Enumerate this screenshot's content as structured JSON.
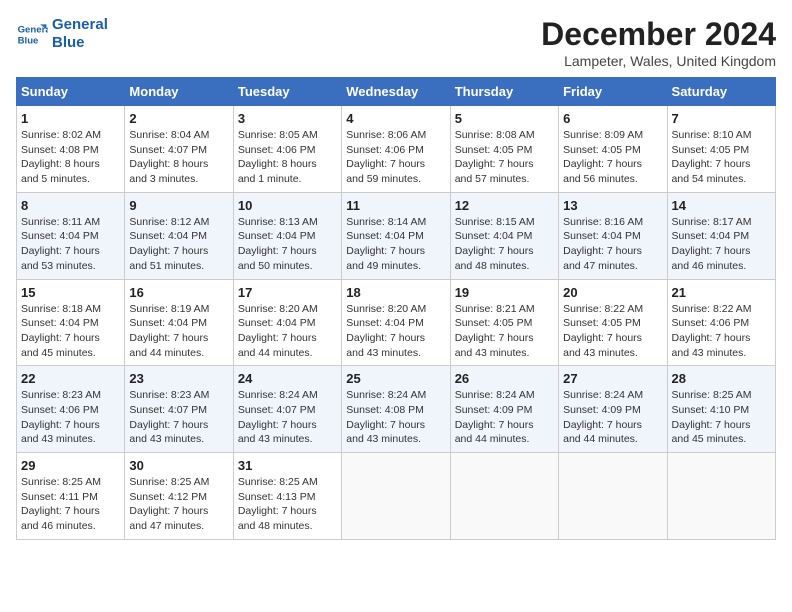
{
  "header": {
    "logo_line1": "General",
    "logo_line2": "Blue",
    "title": "December 2024",
    "location": "Lampeter, Wales, United Kingdom"
  },
  "columns": [
    "Sunday",
    "Monday",
    "Tuesday",
    "Wednesday",
    "Thursday",
    "Friday",
    "Saturday"
  ],
  "weeks": [
    [
      {
        "day": "1",
        "info": "Sunrise: 8:02 AM\nSunset: 4:08 PM\nDaylight: 8 hours\nand 5 minutes."
      },
      {
        "day": "2",
        "info": "Sunrise: 8:04 AM\nSunset: 4:07 PM\nDaylight: 8 hours\nand 3 minutes."
      },
      {
        "day": "3",
        "info": "Sunrise: 8:05 AM\nSunset: 4:06 PM\nDaylight: 8 hours\nand 1 minute."
      },
      {
        "day": "4",
        "info": "Sunrise: 8:06 AM\nSunset: 4:06 PM\nDaylight: 7 hours\nand 59 minutes."
      },
      {
        "day": "5",
        "info": "Sunrise: 8:08 AM\nSunset: 4:05 PM\nDaylight: 7 hours\nand 57 minutes."
      },
      {
        "day": "6",
        "info": "Sunrise: 8:09 AM\nSunset: 4:05 PM\nDaylight: 7 hours\nand 56 minutes."
      },
      {
        "day": "7",
        "info": "Sunrise: 8:10 AM\nSunset: 4:05 PM\nDaylight: 7 hours\nand 54 minutes."
      }
    ],
    [
      {
        "day": "8",
        "info": "Sunrise: 8:11 AM\nSunset: 4:04 PM\nDaylight: 7 hours\nand 53 minutes."
      },
      {
        "day": "9",
        "info": "Sunrise: 8:12 AM\nSunset: 4:04 PM\nDaylight: 7 hours\nand 51 minutes."
      },
      {
        "day": "10",
        "info": "Sunrise: 8:13 AM\nSunset: 4:04 PM\nDaylight: 7 hours\nand 50 minutes."
      },
      {
        "day": "11",
        "info": "Sunrise: 8:14 AM\nSunset: 4:04 PM\nDaylight: 7 hours\nand 49 minutes."
      },
      {
        "day": "12",
        "info": "Sunrise: 8:15 AM\nSunset: 4:04 PM\nDaylight: 7 hours\nand 48 minutes."
      },
      {
        "day": "13",
        "info": "Sunrise: 8:16 AM\nSunset: 4:04 PM\nDaylight: 7 hours\nand 47 minutes."
      },
      {
        "day": "14",
        "info": "Sunrise: 8:17 AM\nSunset: 4:04 PM\nDaylight: 7 hours\nand 46 minutes."
      }
    ],
    [
      {
        "day": "15",
        "info": "Sunrise: 8:18 AM\nSunset: 4:04 PM\nDaylight: 7 hours\nand 45 minutes."
      },
      {
        "day": "16",
        "info": "Sunrise: 8:19 AM\nSunset: 4:04 PM\nDaylight: 7 hours\nand 44 minutes."
      },
      {
        "day": "17",
        "info": "Sunrise: 8:20 AM\nSunset: 4:04 PM\nDaylight: 7 hours\nand 44 minutes."
      },
      {
        "day": "18",
        "info": "Sunrise: 8:20 AM\nSunset: 4:04 PM\nDaylight: 7 hours\nand 43 minutes."
      },
      {
        "day": "19",
        "info": "Sunrise: 8:21 AM\nSunset: 4:05 PM\nDaylight: 7 hours\nand 43 minutes."
      },
      {
        "day": "20",
        "info": "Sunrise: 8:22 AM\nSunset: 4:05 PM\nDaylight: 7 hours\nand 43 minutes."
      },
      {
        "day": "21",
        "info": "Sunrise: 8:22 AM\nSunset: 4:06 PM\nDaylight: 7 hours\nand 43 minutes."
      }
    ],
    [
      {
        "day": "22",
        "info": "Sunrise: 8:23 AM\nSunset: 4:06 PM\nDaylight: 7 hours\nand 43 minutes."
      },
      {
        "day": "23",
        "info": "Sunrise: 8:23 AM\nSunset: 4:07 PM\nDaylight: 7 hours\nand 43 minutes."
      },
      {
        "day": "24",
        "info": "Sunrise: 8:24 AM\nSunset: 4:07 PM\nDaylight: 7 hours\nand 43 minutes."
      },
      {
        "day": "25",
        "info": "Sunrise: 8:24 AM\nSunset: 4:08 PM\nDaylight: 7 hours\nand 43 minutes."
      },
      {
        "day": "26",
        "info": "Sunrise: 8:24 AM\nSunset: 4:09 PM\nDaylight: 7 hours\nand 44 minutes."
      },
      {
        "day": "27",
        "info": "Sunrise: 8:24 AM\nSunset: 4:09 PM\nDaylight: 7 hours\nand 44 minutes."
      },
      {
        "day": "28",
        "info": "Sunrise: 8:25 AM\nSunset: 4:10 PM\nDaylight: 7 hours\nand 45 minutes."
      }
    ],
    [
      {
        "day": "29",
        "info": "Sunrise: 8:25 AM\nSunset: 4:11 PM\nDaylight: 7 hours\nand 46 minutes."
      },
      {
        "day": "30",
        "info": "Sunrise: 8:25 AM\nSunset: 4:12 PM\nDaylight: 7 hours\nand 47 minutes."
      },
      {
        "day": "31",
        "info": "Sunrise: 8:25 AM\nSunset: 4:13 PM\nDaylight: 7 hours\nand 48 minutes."
      },
      {
        "day": "",
        "info": ""
      },
      {
        "day": "",
        "info": ""
      },
      {
        "day": "",
        "info": ""
      },
      {
        "day": "",
        "info": ""
      }
    ]
  ]
}
